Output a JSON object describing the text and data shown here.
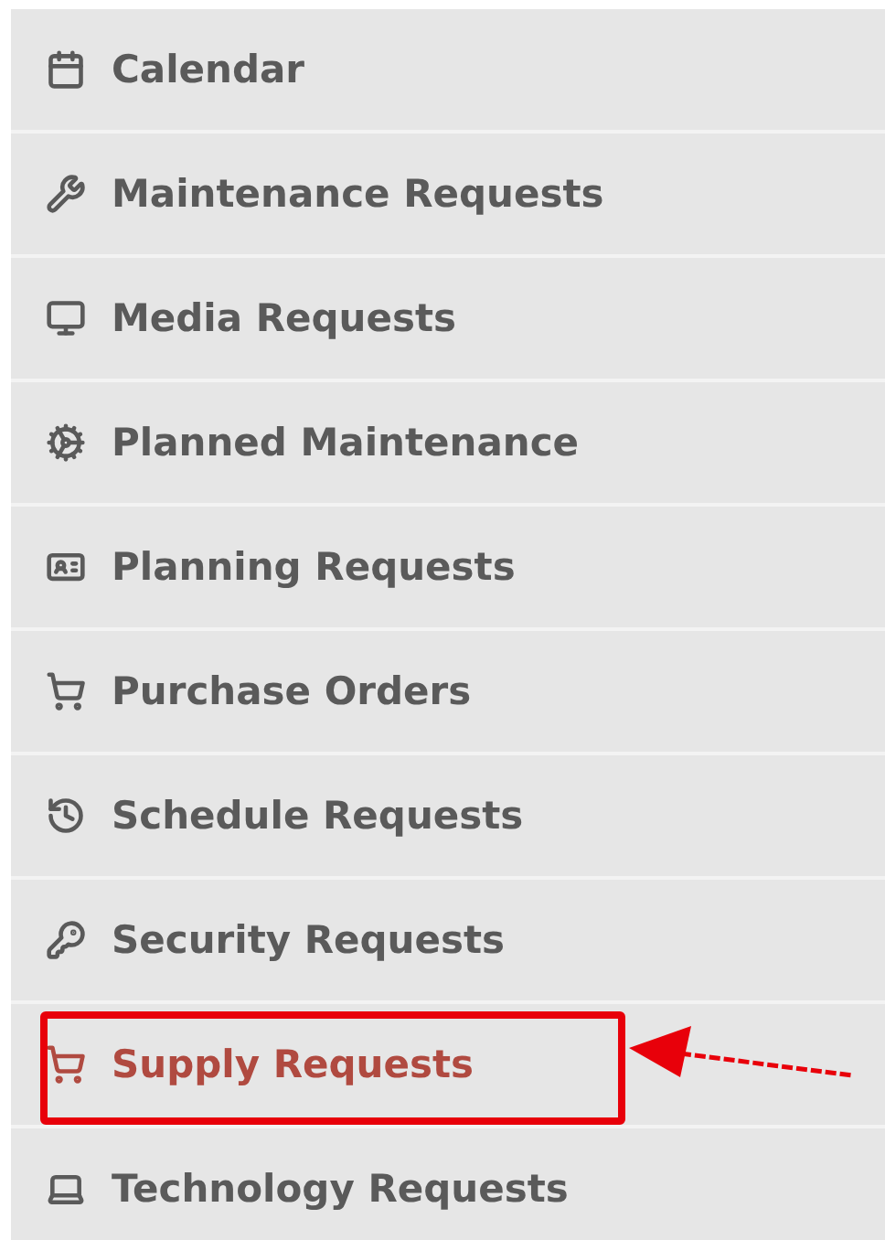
{
  "menu": {
    "items": [
      {
        "label": "Calendar",
        "selected": false,
        "highlighted": false
      },
      {
        "label": "Maintenance Requests",
        "selected": false,
        "highlighted": false
      },
      {
        "label": "Media Requests",
        "selected": false,
        "highlighted": false
      },
      {
        "label": "Planned Maintenance",
        "selected": false,
        "highlighted": false
      },
      {
        "label": "Planning Requests",
        "selected": false,
        "highlighted": false
      },
      {
        "label": "Purchase Orders",
        "selected": false,
        "highlighted": false
      },
      {
        "label": "Schedule Requests",
        "selected": false,
        "highlighted": false
      },
      {
        "label": "Security Requests",
        "selected": false,
        "highlighted": false
      },
      {
        "label": "Supply Requests",
        "selected": true,
        "highlighted": true
      },
      {
        "label": "Technology Requests",
        "selected": false,
        "highlighted": false
      }
    ]
  }
}
